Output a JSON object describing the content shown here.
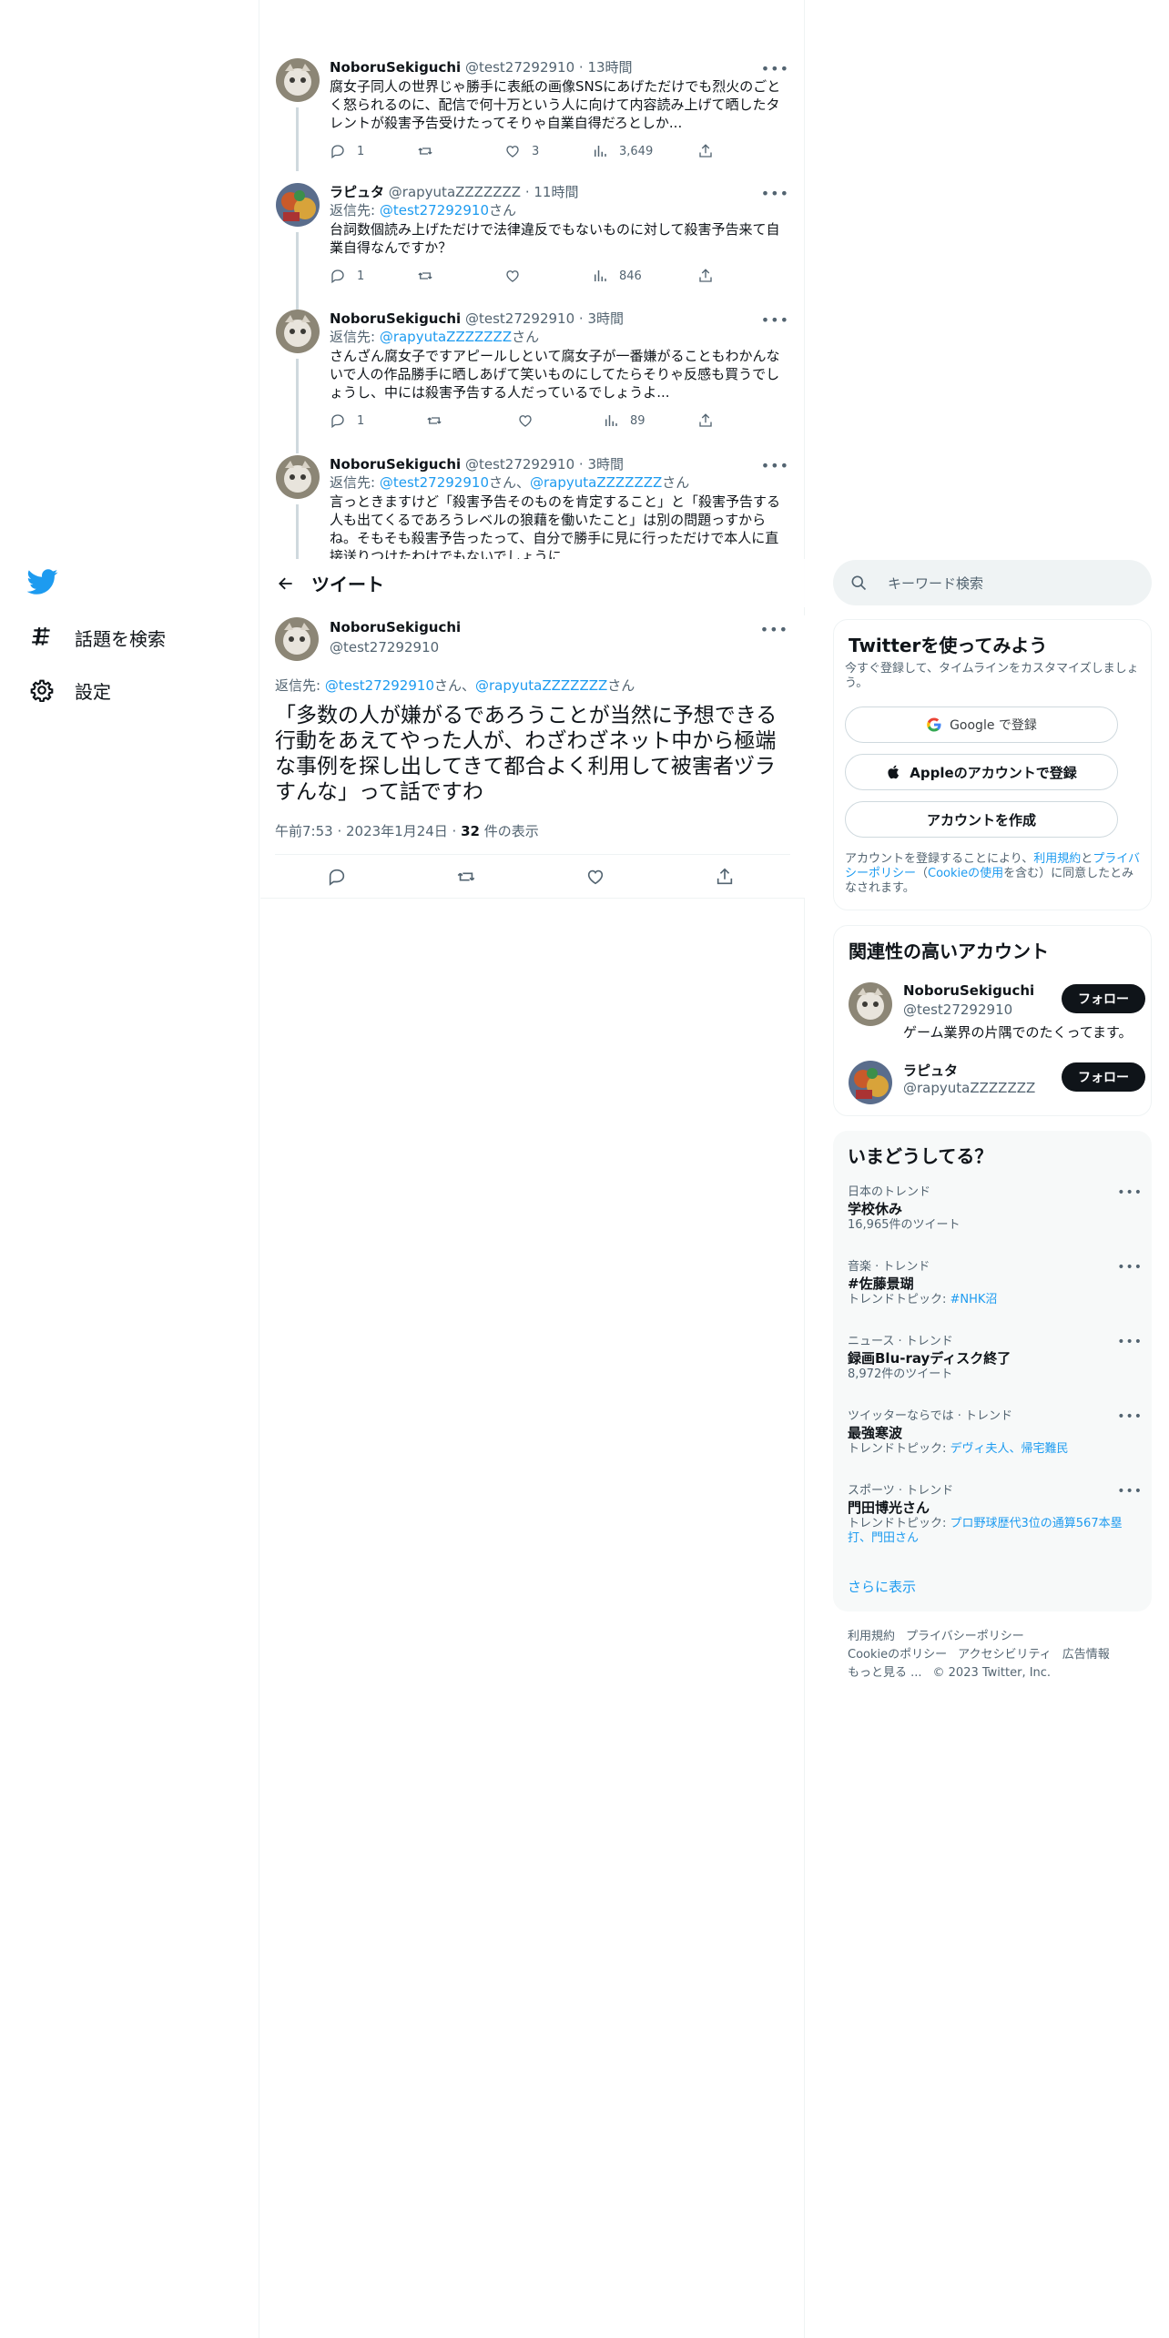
{
  "nav": {
    "explore_label": "話題を検索",
    "settings_label": "設定"
  },
  "header": {
    "title": "ツイート"
  },
  "thread": [
    {
      "name": "NoboruSekiguchi",
      "meta": "@test27292910 · 13時間",
      "reply_prefix": "",
      "reply_mention": "",
      "reply_mention2": "",
      "reply_suffix": "",
      "text": "腐女子同人の世界じゃ勝手に表紙の画像SNSにあげただけでも烈火のごとく怒られるのに、配信で何十万という人に向けて内容読み上げて晒したタレントが殺害予告受けたってそりゃ自業自得だろとしか...",
      "reply_count": "1",
      "retweet_count": "",
      "like_count": "3",
      "view_count": "3,649"
    },
    {
      "name": "ラピュタ",
      "meta": "@rapyutaZZZZZZZ · 11時間",
      "reply_prefix": "返信先: ",
      "reply_mention": "@test27292910",
      "reply_mention2": "",
      "reply_suffix": "さん",
      "text": "台詞数個読み上げただけで法律違反でもないものに対して殺害予告来て自業自得なんですか？",
      "reply_count": "1",
      "retweet_count": "",
      "like_count": "",
      "view_count": "846"
    },
    {
      "name": "NoboruSekiguchi",
      "meta": "@test27292910 · 3時間",
      "reply_prefix": "返信先: ",
      "reply_mention": "@rapyutaZZZZZZZ",
      "reply_mention2": "",
      "reply_suffix": "さん",
      "text": "さんざん腐女子ですアピールしといて腐女子が一番嫌がることもわかんないで人の作品勝手に晒しあげて笑いものにしてたらそりゃ反感も買うでしょうし、中には殺害予告する人だっているでしょうよ...",
      "reply_count": "1",
      "retweet_count": "",
      "like_count": "",
      "view_count": "89"
    },
    {
      "name": "NoboruSekiguchi",
      "meta": "@test27292910 · 3時間",
      "reply_prefix": "返信先: ",
      "reply_mention": "@test27292910",
      "reply_mention_sep": "さん、",
      "reply_mention2": "@rapyutaZZZZZZZ",
      "reply_suffix": "さん",
      "text": "言っときますけど「殺害予告そのものを肯定すること」と「殺害予告する人も出てくるであろうレベルの狼藉を働いたこと」は別の問題っすからね。そもそも殺害予告ったって、自分で勝手に見に行っただけで本人に直接送りつけたわけでもないでしょうに"
    }
  ],
  "focus": {
    "name": "NoboruSekiguchi",
    "handle": "@test27292910",
    "reply_prefix": "返信先: ",
    "reply_mention": "@test27292910",
    "reply_sep": "さん、",
    "reply_mention2": "@rapyutaZZZZZZZ",
    "reply_suffix": "さん",
    "text": "「多数の人が嫌がるであろうことが当然に予想できる行動をあえてやった人が、わざわざネット中から極端な事例を探し出してきて都合よく利用して被害者ヅラすんな」って話ですわ",
    "time": "午前7:53 · 2023年1月24日 · ",
    "views_count": "32",
    "views_label": " 件の表示"
  },
  "search": {
    "placeholder": "キーワード検索"
  },
  "signup": {
    "title": "Twitterを使ってみよう",
    "subtitle": "今すぐ登録して、タイムラインをカスタマイズしましょう。",
    "google_label": "Google で登録",
    "apple_label": "Appleのアカウントで登録",
    "create_label": "アカウントを作成",
    "legal_1": "アカウントを登録することにより、",
    "legal_terms": "利用規約",
    "legal_2": "と",
    "legal_privacy": "プライバシーポリシー",
    "legal_3": "（",
    "legal_cookie": "Cookieの使用",
    "legal_4": "を含む）に同意したとみなされます。"
  },
  "related": {
    "title": "関連性の高いアカウント",
    "accounts": [
      {
        "name": "NoboruSekiguchi",
        "handle": "@test27292910",
        "bio": "ゲーム業界の片隅でのたくってます。",
        "follow_label": "フォロー"
      },
      {
        "name": "ラピュタ",
        "handle": "@rapyutaZZZZZZZ",
        "bio": "",
        "follow_label": "フォロー"
      }
    ]
  },
  "trends": {
    "title": "いまどうしてる？",
    "items": [
      {
        "category": "日本のトレンド",
        "name": "学校休み",
        "detail_prefix": "16,965件のツイート",
        "detail_link": ""
      },
      {
        "category": "音楽 · トレンド",
        "name": "#佐藤景瑚",
        "detail_prefix": "トレンドトピック: ",
        "detail_link": "#NHK沼"
      },
      {
        "category": "ニュース · トレンド",
        "name": "録画Blu-rayディスク終了",
        "detail_prefix": "8,972件のツイート",
        "detail_link": ""
      },
      {
        "category": "ツイッターならでは · トレンド",
        "name": "最強寒波",
        "detail_prefix": "トレンドトピック: ",
        "detail_link": "デヴィ夫人、帰宅難民"
      },
      {
        "category": "スポーツ · トレンド",
        "name": "門田博光さん",
        "detail_prefix": "トレンドトピック: ",
        "detail_link": "プロ野球歴代3位の通算567本塁打、門田さん"
      }
    ],
    "show_more": "さらに表示"
  },
  "footer": {
    "terms": "利用規約",
    "privacy": "プライバシーポリシー",
    "cookie": "Cookieのポリシー",
    "accessibility": "アクセシビリティ",
    "ads": "広告情報",
    "more": "もっと見る ...",
    "copyright": "© 2023 Twitter, Inc."
  },
  "colors": {
    "accent": "#1d9bf0",
    "text": "#0f1419",
    "muted": "#536471",
    "border": "#eff3f4"
  }
}
